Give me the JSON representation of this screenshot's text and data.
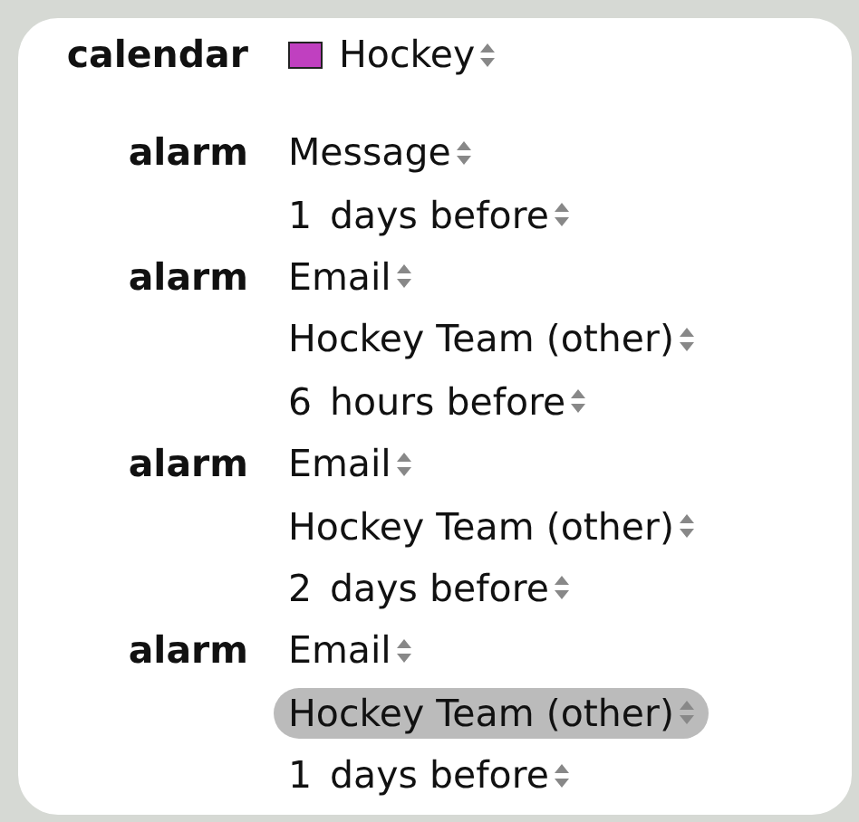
{
  "calendar": {
    "label": "calendar",
    "name": "Hockey",
    "color": "#c040c0"
  },
  "alarms": [
    {
      "label": "alarm",
      "fields": [
        {
          "kind": "popup",
          "text": "Message",
          "highlighted": false
        },
        {
          "kind": "offset",
          "amount": "1",
          "text": "days before",
          "highlighted": false
        }
      ]
    },
    {
      "label": "alarm",
      "fields": [
        {
          "kind": "popup",
          "text": "Email",
          "highlighted": false
        },
        {
          "kind": "popup",
          "text": "Hockey Team (other)",
          "highlighted": false
        },
        {
          "kind": "offset",
          "amount": "6",
          "text": "hours before",
          "highlighted": false
        }
      ]
    },
    {
      "label": "alarm",
      "fields": [
        {
          "kind": "popup",
          "text": "Email",
          "highlighted": false
        },
        {
          "kind": "popup",
          "text": "Hockey Team (other)",
          "highlighted": false
        },
        {
          "kind": "offset",
          "amount": "2",
          "text": "days before",
          "highlighted": false
        }
      ]
    },
    {
      "label": "alarm",
      "fields": [
        {
          "kind": "popup",
          "text": "Email",
          "highlighted": false
        },
        {
          "kind": "popup",
          "text": "Hockey Team (other)",
          "highlighted": true
        },
        {
          "kind": "offset",
          "amount": "1",
          "text": "days before",
          "highlighted": false
        }
      ]
    }
  ]
}
